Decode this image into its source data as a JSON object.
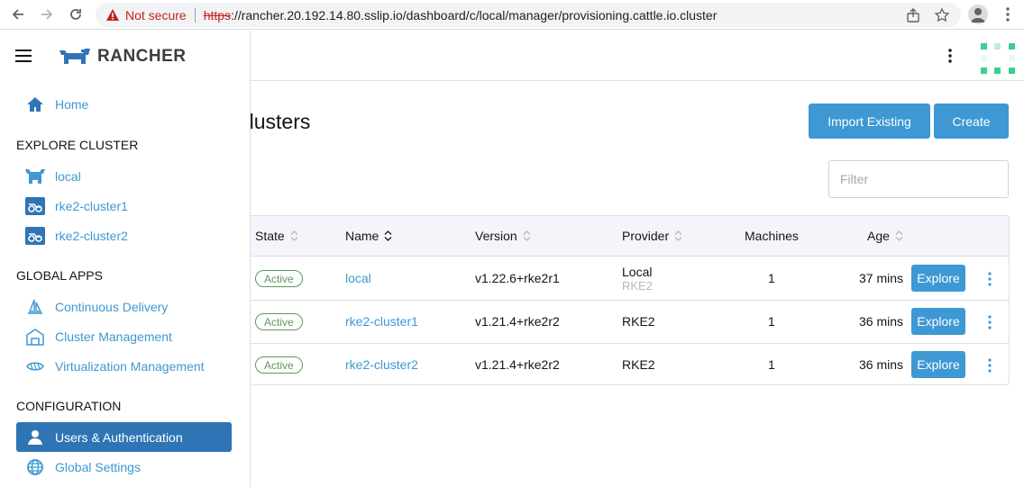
{
  "browser": {
    "not_secure": "Not secure",
    "url_scheme": "https",
    "url_rest": "://rancher.20.192.14.80.sslip.io/dashboard/c/local/manager/provisioning.cattle.io.cluster"
  },
  "sidebar": {
    "brand": "RANCHER",
    "home": "Home",
    "sections": {
      "explore": "EXPLORE CLUSTER",
      "global_apps": "GLOBAL APPS",
      "configuration": "CONFIGURATION"
    },
    "clusters": [
      "local",
      "rke2-cluster1",
      "rke2-cluster2"
    ],
    "apps": [
      "Continuous Delivery",
      "Cluster Management",
      "Virtualization Management"
    ],
    "config": [
      "Users & Authentication",
      "Global Settings"
    ]
  },
  "page": {
    "title": "Clusters",
    "import_button": "Import Existing",
    "create_button": "Create",
    "filter_placeholder": "Filter"
  },
  "table": {
    "headers": {
      "state": "State",
      "name": "Name",
      "version": "Version",
      "provider": "Provider",
      "machines": "Machines",
      "age": "Age"
    },
    "explore_label": "Explore",
    "rows": [
      {
        "state": "Active",
        "name": "local",
        "version": "v1.22.6+rke2r1",
        "provider": "Local",
        "provider_sub": "RKE2",
        "machines": "1",
        "age": "37 mins"
      },
      {
        "state": "Active",
        "name": "rke2-cluster1",
        "version": "v1.21.4+rke2r2",
        "provider": "RKE2",
        "provider_sub": "",
        "machines": "1",
        "age": "36 mins"
      },
      {
        "state": "Active",
        "name": "rke2-cluster2",
        "version": "v1.21.4+rke2r2",
        "provider": "RKE2",
        "provider_sub": "",
        "machines": "1",
        "age": "36 mins"
      }
    ]
  },
  "colors": {
    "accent": "#3d98d3",
    "active_nav": "#2f75b5",
    "active_badge": "#5d995d"
  }
}
